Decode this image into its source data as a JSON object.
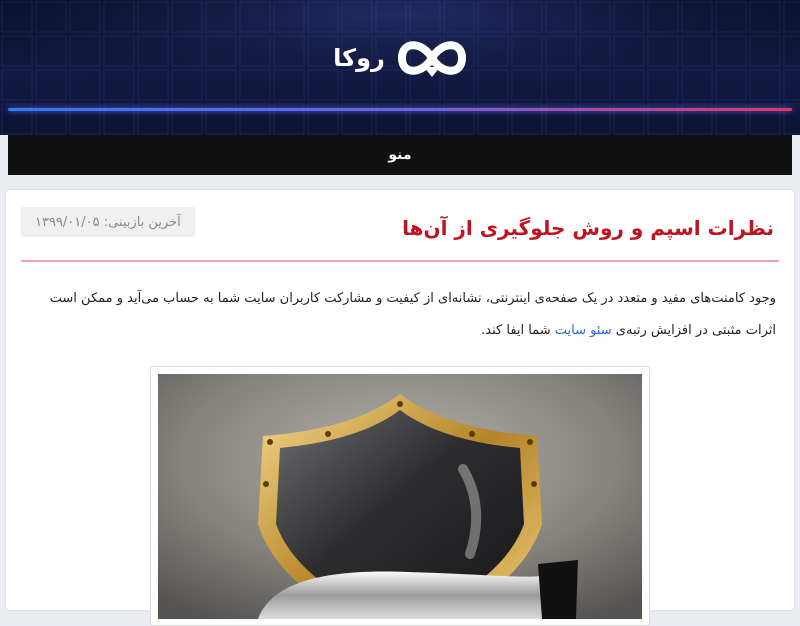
{
  "header": {
    "brand_name": "روکا",
    "logo_icon": "roka-logo-icon",
    "accent_colors": [
      "#2f7bff",
      "#e8335f"
    ]
  },
  "nav": {
    "menu_label": "منو"
  },
  "article": {
    "title": "نظرات اسپم و روش جلوگیری از آن‌ها",
    "last_updated": "آخرین بازبینی: ۱۳۹۹/۰۱/۰۵",
    "paragraph_before_link": "وجود کامنت‌های مفید و متعدد در یک صفحه‌ی اینترنتی، نشانه‌ای از کیفیت و مشارکت کاربران سایت شما به حساب می‌آید و ممکن است اثرات مثبتی در افزایش رتبه‌ی ",
    "link_text": "سئو سایت",
    "paragraph_after_link": " شما ایفا کند.",
    "title_color": "#c1121f",
    "link_color": "#2468d6",
    "image_icon": "shield-icon"
  }
}
